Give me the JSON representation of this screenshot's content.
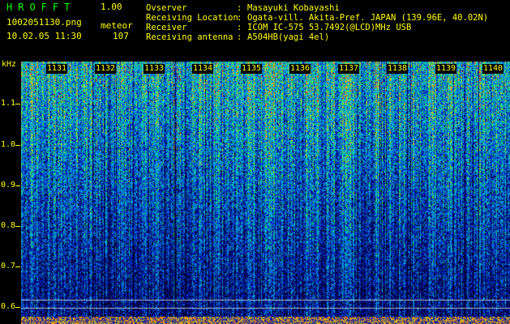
{
  "header": {
    "app_name": "HROFFT",
    "version": "1.00",
    "filename": "1002051130.png",
    "datetime": "10.02.05 11:30",
    "mode": "meteor",
    "count": "107",
    "info": [
      {
        "label": "Ovserver",
        "value": "Masayuki Kobayashi"
      },
      {
        "label": "Receiving Location",
        "value": "Ogata-vill. Akita-Pref. JAPAN (139.96E, 40.02N)"
      },
      {
        "label": "Receiver",
        "value": "ICOM IC-575 53.7492(@LCD)MHz USB"
      },
      {
        "label": "Receiving antenna",
        "value": "A504HB(yagi 4el)"
      }
    ],
    "separator": ":"
  },
  "spectrogram": {
    "y_unit": "kHz",
    "y_ticks": [
      "1.1",
      "1.0",
      "0.9",
      "0.8",
      "0.7",
      "0.6"
    ],
    "x_ticks": [
      "1131",
      "1132",
      "1133",
      "1134",
      "1135",
      "1136",
      "1137",
      "1138",
      "1139",
      "1140"
    ],
    "colors": {
      "background": "#000000",
      "label": "#ffff00",
      "title": "#00ff00",
      "palette_low": "#0a1a7a",
      "palette_mid": "#00c8d8",
      "palette_high": "#ff3030"
    }
  }
}
